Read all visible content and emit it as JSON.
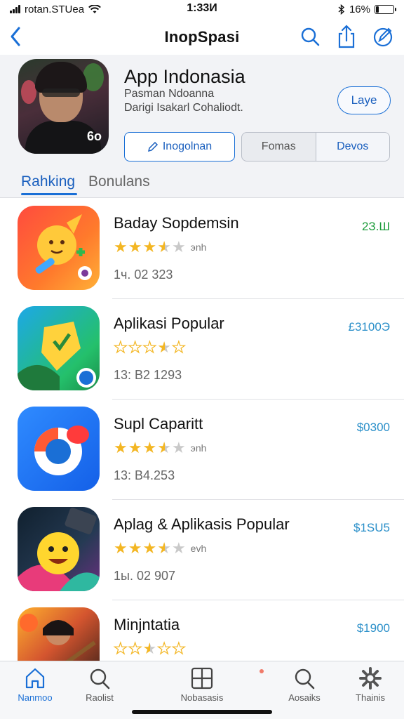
{
  "status": {
    "carrier": "rotan.STUea",
    "time": "1:33И",
    "battery": "16%",
    "battery_level": 0.16
  },
  "nav": {
    "title": "InopSpasi",
    "icons": [
      "back-chevron-icon",
      "search-icon",
      "share-icon",
      "edit-icon"
    ]
  },
  "header": {
    "app_name": "App Indonasia",
    "sub1": "Pasman Ndoanna",
    "sub2": "Darigi Isakarl Cohaliodt.",
    "save_label": "Laye",
    "primary_label": "Inogolnan",
    "seg_left": "Fomas",
    "seg_right": "Devos"
  },
  "tabs": {
    "active": "Rahking",
    "inactive": "Bonulans"
  },
  "apps": [
    {
      "name": "Baday Sopdemsin",
      "price": "2З.Ш",
      "price_color": "#1f9d3d",
      "rating": 3.5,
      "style": "filled",
      "count": "эnh",
      "meta": "1ч. 02 323"
    },
    {
      "name": "Aplikasi Popular",
      "price": "£3100Э",
      "price_color": "#2a8fc9",
      "rating": 3.5,
      "style": "outline",
      "count": "",
      "meta": "13: B2 1293"
    },
    {
      "name": "Supl Caparitt",
      "price": "$0300",
      "price_color": "#2a8fc9",
      "rating": 3.5,
      "style": "filled",
      "count": "эnh",
      "meta": "13: B4.253"
    },
    {
      "name": "Aplag & Aplikasis Popular",
      "price": "$1SU5",
      "price_color": "#2a8fc9",
      "rating": 3.5,
      "style": "filled",
      "count": "evh",
      "meta": "1ы. 02 907"
    },
    {
      "name": "Minjntatia",
      "price": "$1900",
      "price_color": "#2a8fc9",
      "rating": 2.5,
      "style": "outline",
      "count": "",
      "meta": ""
    }
  ],
  "tabbar": [
    {
      "label": "Nanmoo",
      "icon": "home-icon",
      "active": true
    },
    {
      "label": "Raolist",
      "icon": "search-icon",
      "active": false
    },
    {
      "label": "Nobasasis",
      "icon": "grid-icon",
      "active": false
    },
    {
      "label": "Aosaiks",
      "icon": "search-icon",
      "active": false
    },
    {
      "label": "Thainis",
      "icon": "gear-icon",
      "active": false
    }
  ]
}
